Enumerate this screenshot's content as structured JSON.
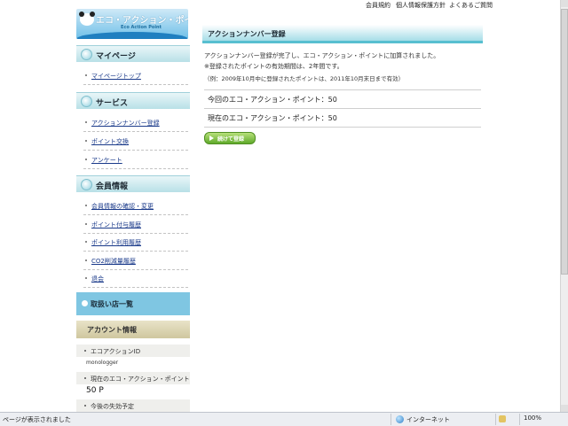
{
  "top_links": [
    "会員規約",
    "個人情報保護方針",
    "よくあるご質問"
  ],
  "logo": {
    "title": "エコ・アクション・ポイント",
    "subtitle": "Eco Action Point"
  },
  "sidebar": {
    "mypage": {
      "heading": "マイページ",
      "items": [
        "マイページトップ"
      ]
    },
    "service": {
      "heading": "サービス",
      "items": [
        "アクションナンバー登録",
        "ポイント交換",
        "アンケート"
      ]
    },
    "member": {
      "heading": "会員情報",
      "items": [
        "会員情報の確認・変更",
        "ポイント付与履歴",
        "ポイント利用履歴",
        "CO2削減量履歴",
        "退会"
      ]
    },
    "shop": {
      "label": "取扱い店一覧"
    },
    "account": {
      "heading": "アカウント情報",
      "id_label": "エコアクションID",
      "id_value": "monologger",
      "points_label": "現在のエコ・アクション・ポイント",
      "points_value": "50 P",
      "expire_label": "今後の失効予定"
    }
  },
  "main": {
    "title": "アクションナンバー登録",
    "msg1": "アクションナンバー登録が完了し、エコ・アクション・ポイントに加算されました。",
    "msg2": "※登録されたポイントの有効期間は、2年間です。",
    "msg3": "（例：2009年10月中に登録されたポイントは、2011年10月末日まで有効）",
    "this_points": "今回のエコ・アクション・ポイント：50",
    "current_points": "現在のエコ・アクション・ポイント：50",
    "continue_label": "続けて登録"
  },
  "status_bar": {
    "text": "ページが表示されました",
    "zone": "インターネット",
    "zoom": "100%"
  },
  "colors": {
    "accent": "#58bfd0",
    "header_bg": "#b8e0e7",
    "button": "#5faa2a"
  }
}
